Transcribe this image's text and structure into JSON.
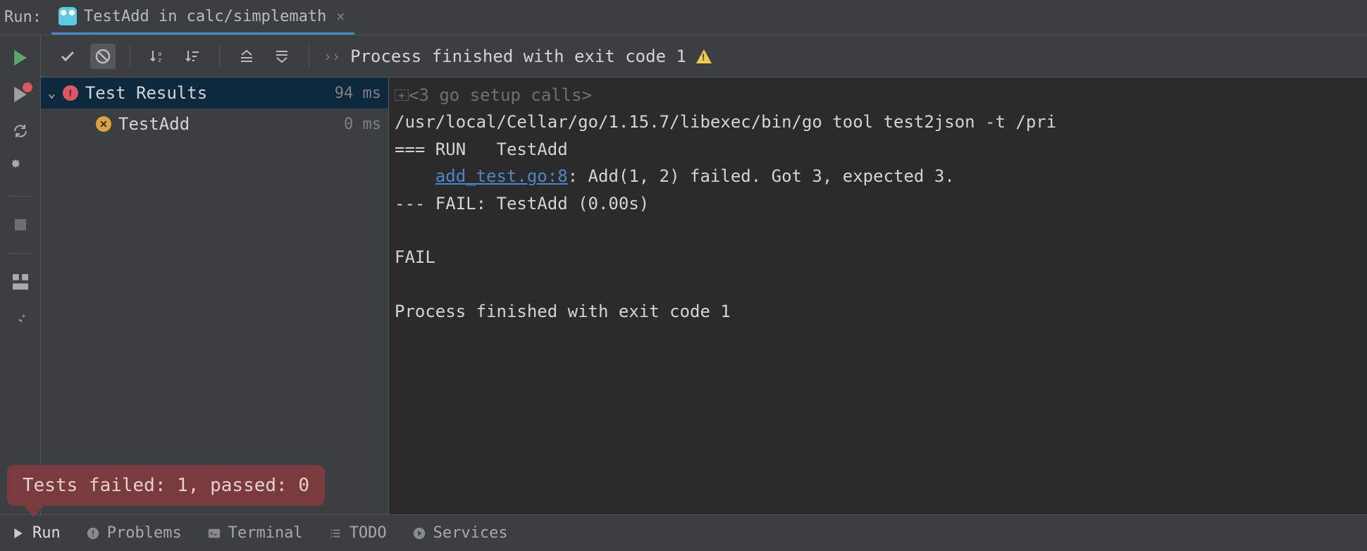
{
  "header": {
    "run_label": "Run:",
    "tab_title": "TestAdd in calc/simplemath",
    "status_line": "Process finished with exit code 1"
  },
  "toolbar": {
    "icons": [
      "check",
      "disabled",
      "sort-alpha",
      "sort-tree",
      "expand-all",
      "collapse-all"
    ]
  },
  "tree": {
    "root": {
      "name": "Test Results",
      "time": "94 ms"
    },
    "items": [
      {
        "name": "TestAdd",
        "time": "0 ms",
        "status": "failed"
      }
    ]
  },
  "console": {
    "fold_line": "<3 go setup calls>",
    "cmd": "/usr/local/Cellar/go/1.15.7/libexec/bin/go tool test2json -t /pri",
    "run_line": "=== RUN   TestAdd",
    "link_text": "add_test.go:8",
    "link_tail": ": Add(1, 2) failed. Got 3, expected 3.",
    "fail_line": "--- FAIL: TestAdd (0.00s)",
    "fail_word": "FAIL",
    "exit_line": "Process finished with exit code 1"
  },
  "tooltip": "Tests failed: 1, passed: 0",
  "bottom": {
    "run": "Run",
    "problems": "Problems",
    "terminal": "Terminal",
    "todo": "TODO",
    "services": "Services"
  }
}
